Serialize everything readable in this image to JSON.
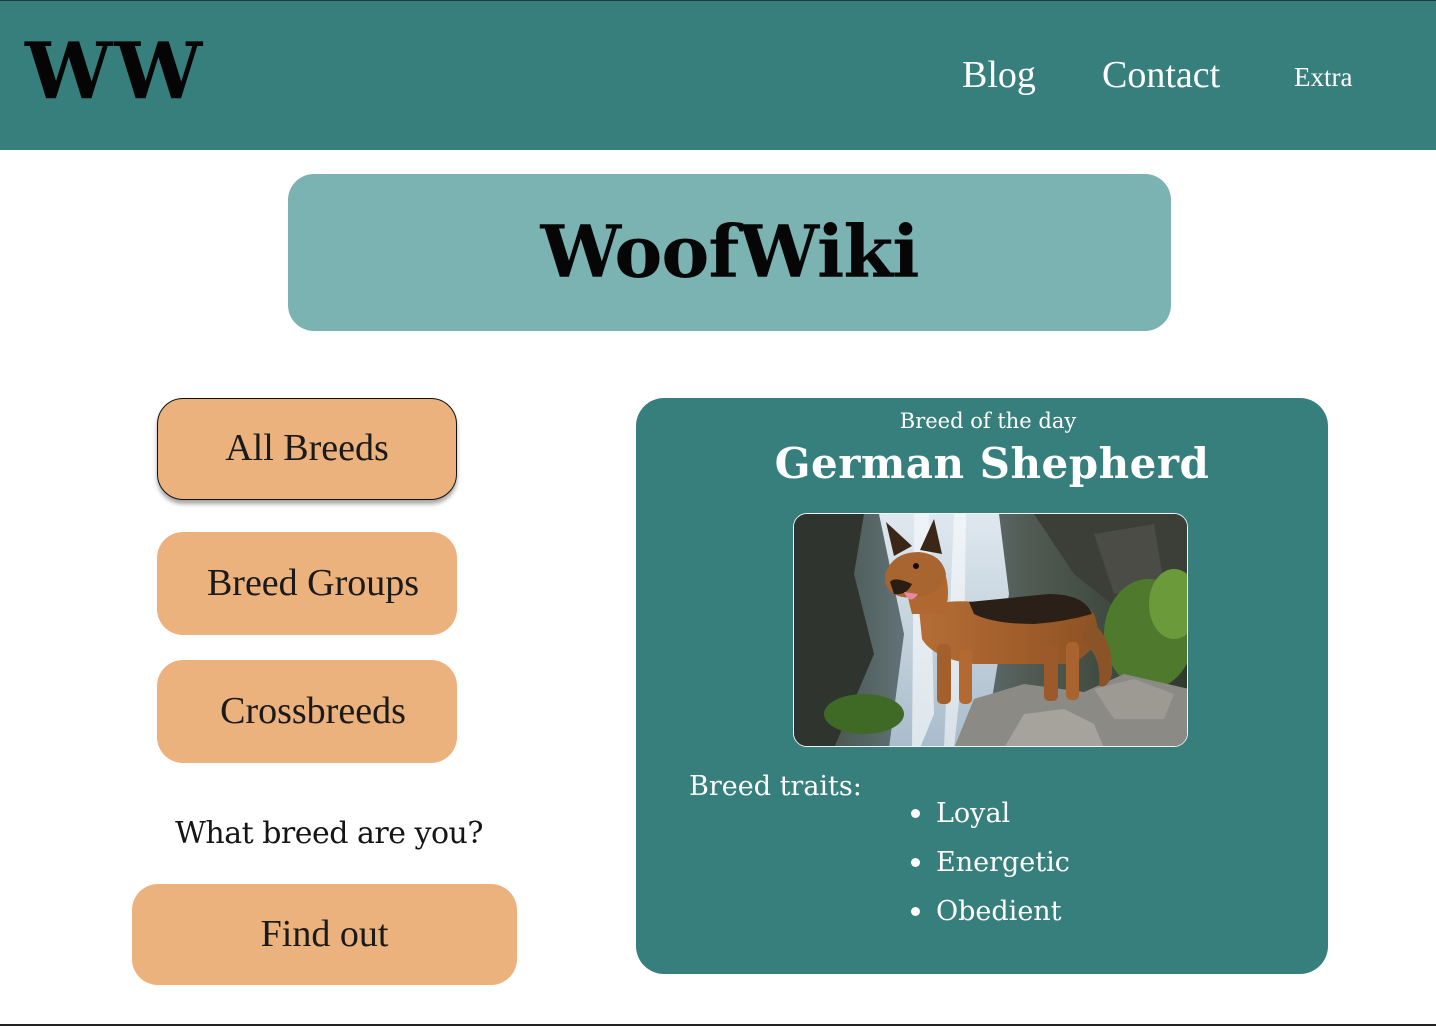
{
  "header": {
    "logo": "WW",
    "nav": [
      {
        "label": "Blog"
      },
      {
        "label": "Contact"
      },
      {
        "label": "Extra"
      }
    ]
  },
  "hero": {
    "title": "WoofWiki"
  },
  "sidebar": {
    "buttons": [
      {
        "label": "All Breeds"
      },
      {
        "label": "Breed Groups"
      },
      {
        "label": "Crossbreeds"
      }
    ],
    "quiz_prompt": "What breed are you?",
    "quiz_button": "Find out"
  },
  "featured": {
    "kicker": "Breed of the day",
    "breed_name": "German Shepherd",
    "traits_label": "Breed traits:",
    "traits": [
      "Loyal",
      "Energetic",
      "Obedient"
    ]
  },
  "colors": {
    "header_bg": "#377f7d",
    "hero_bg": "#7bb2b2",
    "button_bg": "#ebb27d",
    "card_bg": "#377f7d"
  }
}
